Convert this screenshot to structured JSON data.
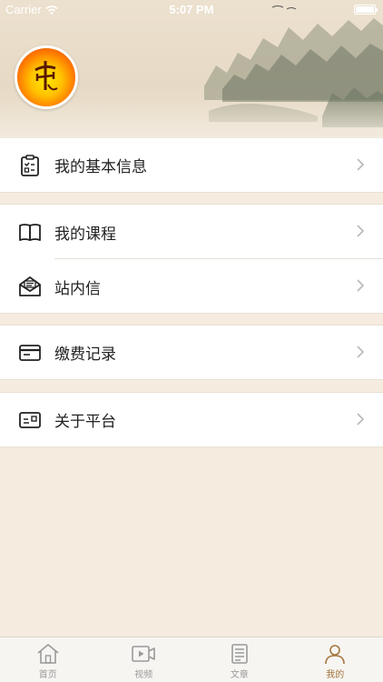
{
  "status_bar": {
    "carrier": "Carrier",
    "time": "5:07 PM"
  },
  "menu": {
    "groups": [
      {
        "items": [
          {
            "label": "我的基本信息",
            "icon": "clipboard-checklist-icon"
          }
        ]
      },
      {
        "items": [
          {
            "label": "我的课程",
            "icon": "open-book-icon"
          },
          {
            "label": "站内信",
            "icon": "envelope-letter-icon"
          }
        ]
      },
      {
        "items": [
          {
            "label": "缴费记录",
            "icon": "card-icon"
          }
        ]
      },
      {
        "items": [
          {
            "label": "关于平台",
            "icon": "info-card-icon"
          }
        ]
      }
    ]
  },
  "tabbar": {
    "tabs": [
      {
        "label": "首页",
        "icon": "home-icon",
        "active": false
      },
      {
        "label": "视频",
        "icon": "video-icon",
        "active": false
      },
      {
        "label": "文章",
        "icon": "article-icon",
        "active": false
      },
      {
        "label": "我的",
        "icon": "profile-icon",
        "active": true
      }
    ]
  },
  "colors": {
    "accent": "#a5763d",
    "background": "#f5ecdf",
    "inactive": "#9a9a9a"
  }
}
